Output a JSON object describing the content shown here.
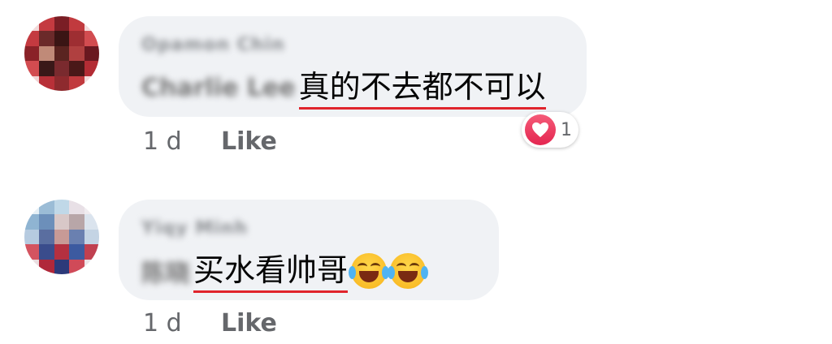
{
  "comments": [
    {
      "author_name": "Opamon Chin",
      "mention": "Charlie Lee",
      "text": "真的不去都不可以",
      "emojis": [],
      "time": "1 d",
      "like_label": "Like",
      "reaction": {
        "icon": "heart-icon",
        "count": "1"
      }
    },
    {
      "author_name": "Yiqy Minh",
      "mention": "陈晓",
      "text": "买水看帅哥",
      "emojis": [
        "face-with-tears-of-joy-icon",
        "face-with-tears-of-joy-icon"
      ],
      "time": "1 d",
      "like_label": "Like",
      "reaction": null
    }
  ],
  "colors": {
    "bubble_bg": "#f0f2f5",
    "meta_text": "#65676b",
    "underline": "#e0242c",
    "reaction_heart": "#e42650"
  }
}
